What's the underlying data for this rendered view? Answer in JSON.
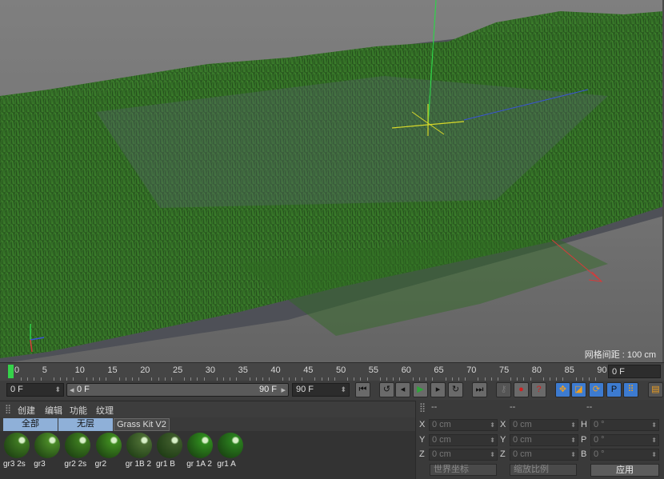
{
  "viewport": {
    "grid_readout": "网格间距 : 100 cm"
  },
  "timeline": {
    "ticks": [
      "0",
      "5",
      "10",
      "15",
      "20",
      "25",
      "30",
      "35",
      "40",
      "45",
      "50",
      "55",
      "60",
      "65",
      "70",
      "75",
      "80",
      "85",
      "90"
    ],
    "end_frame": "0 F"
  },
  "transport": {
    "current_frame": "0 F",
    "range_start": "0 F",
    "range_end": "90 F",
    "max_frame": "90 F"
  },
  "materials": {
    "menu": [
      "创建",
      "编辑",
      "功能",
      "纹理"
    ],
    "tabs": [
      "全部",
      "无层",
      "Grass Kit V2"
    ],
    "items": [
      {
        "label": "gr3 2s",
        "color": "#3f7a22"
      },
      {
        "label": "gr3",
        "color": "#4a8a27"
      },
      {
        "label": "gr2 2s",
        "color": "#3c7a1f"
      },
      {
        "label": "gr2",
        "color": "#3f8a20"
      },
      {
        "label": "gr 1B 2",
        "color": "#4b6d33"
      },
      {
        "label": "gr1 B",
        "color": "#3d5b2a"
      },
      {
        "label": "gr 1A 2",
        "color": "#2f8a1e"
      },
      {
        "label": "gr1 A",
        "color": "#2a7f1e"
      }
    ]
  },
  "coordinates": {
    "header": [
      "--",
      "--",
      "--"
    ],
    "rows": [
      {
        "a": "X",
        "av": "0 cm",
        "b": "X",
        "bv": "0 cm",
        "c": "H",
        "cv": "0 °"
      },
      {
        "a": "Y",
        "av": "0 cm",
        "b": "Y",
        "bv": "0 cm",
        "c": "P",
        "cv": "0 °"
      },
      {
        "a": "Z",
        "av": "0 cm",
        "b": "Z",
        "bv": "0 cm",
        "c": "B",
        "cv": "0 °"
      }
    ],
    "world_coords": "世界坐标",
    "scale_mode": "缩放比例",
    "apply_label": "应用"
  },
  "colors": {
    "playhead": "#35d24a",
    "grass": "#2f6b22",
    "axis_y": "#2fd24a",
    "axis_x": "#d83a3a",
    "axis_z": "#3a52d8"
  }
}
